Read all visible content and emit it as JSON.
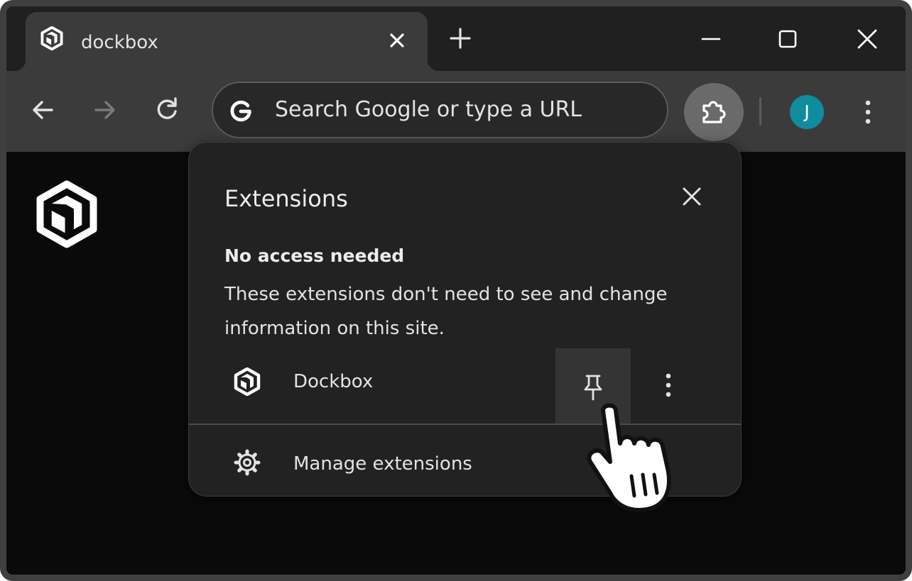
{
  "tab": {
    "title": "dockbox",
    "favicon_icon": "dockbox-logo-icon"
  },
  "omnibox": {
    "placeholder": "Search Google or type a URL"
  },
  "profile": {
    "initial": "J",
    "color": "#0f8d9e"
  },
  "popup": {
    "title": "Extensions",
    "section_heading": "No access needed",
    "section_description": "These extensions don't need to see and change information on this site.",
    "extension": {
      "name": "Dockbox",
      "icon": "dockbox-logo-icon"
    },
    "manage_label": "Manage extensions"
  },
  "colors": {
    "frame": "#3f3f3f",
    "tab_active": "#3b3b3b",
    "toolbar": "#3b3b3b",
    "page_background": "#0a0a0a",
    "popup_background": "#222222",
    "text": "#e3e3e3"
  }
}
